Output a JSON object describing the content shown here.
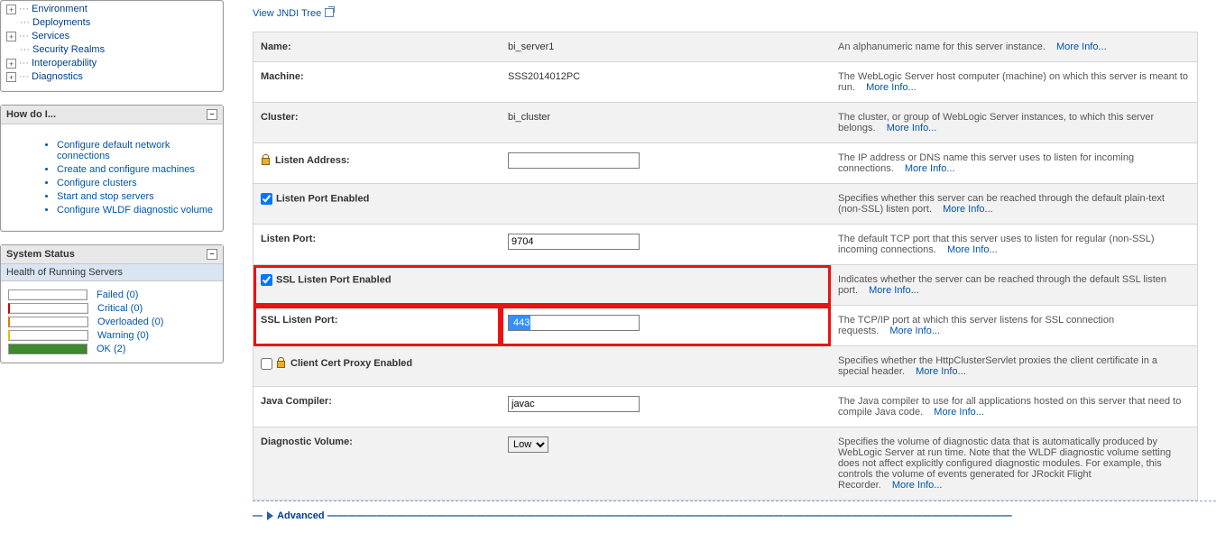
{
  "tree": {
    "items": [
      {
        "label": "Environment",
        "expand": true
      },
      {
        "label": "Deployments",
        "expand": false
      },
      {
        "label": "Services",
        "expand": true
      },
      {
        "label": "Security Realms",
        "expand": false
      },
      {
        "label": "Interoperability",
        "expand": true
      },
      {
        "label": "Diagnostics",
        "expand": true
      }
    ]
  },
  "howdoi": {
    "title": "How do I...",
    "items": [
      "Configure default network connections",
      "Create and configure machines",
      "Configure clusters",
      "Start and stop servers",
      "Configure WLDF diagnostic volume"
    ]
  },
  "status": {
    "title": "System Status",
    "subtitle": "Health of Running Servers",
    "rows": [
      {
        "label": "Failed (0)"
      },
      {
        "label": "Critical (0)"
      },
      {
        "label": "Overloaded (0)"
      },
      {
        "label": "Warning (0)"
      },
      {
        "label": "OK (2)"
      }
    ]
  },
  "jndi": {
    "label": "View JNDI Tree"
  },
  "fields": {
    "name": {
      "label": "Name:",
      "value": "bi_server1",
      "desc": "An alphanumeric name for this server instance.",
      "more": "More Info..."
    },
    "machine": {
      "label": "Machine:",
      "value": "SSS2014012PC",
      "desc": "The WebLogic Server host computer (machine) on which this server is meant to run.",
      "more": "More Info..."
    },
    "cluster": {
      "label": "Cluster:",
      "value": "bi_cluster",
      "desc": "The cluster, or group of WebLogic Server instances, to which this server belongs.",
      "more": "More Info..."
    },
    "listenaddr": {
      "label": "Listen Address:",
      "value": "",
      "desc": "The IP address or DNS name this server uses to listen for incoming connections.",
      "more": "More Info..."
    },
    "lpe": {
      "label": "Listen Port Enabled",
      "desc": "Specifies whether this server can be reached through the default plain-text (non-SSL) listen port.",
      "more": "More Info..."
    },
    "lp": {
      "label": "Listen Port:",
      "value": "9704",
      "desc": "The default TCP port that this server uses to listen for regular (non-SSL) incoming connections.",
      "more": "More Info..."
    },
    "sslpe": {
      "label": "SSL Listen Port Enabled",
      "desc": "Indicates whether the server can be reached through the default SSL listen port.",
      "more": "More Info..."
    },
    "sslp": {
      "label": "SSL Listen Port:",
      "value": "443",
      "desc": "The TCP/IP port at which this server listens for SSL connection requests.",
      "more": "More Info..."
    },
    "ccpe": {
      "label": "Client Cert Proxy Enabled",
      "desc": "Specifies whether the HttpClusterServlet proxies the client certificate in a special header.",
      "more": "More Info..."
    },
    "jc": {
      "label": "Java Compiler:",
      "value": "javac",
      "desc": "The Java compiler to use for all applications hosted on this server that need to compile Java code.",
      "more": "More Info..."
    },
    "dv": {
      "label": "Diagnostic Volume:",
      "value": "Low",
      "desc": "Specifies the volume of diagnostic data that is automatically produced by WebLogic Server at run time. Note that the WLDF diagnostic volume setting does not affect explicitly configured diagnostic modules. For example, this controls the volume of events generated for JRockit Flight Recorder.",
      "more": "More Info..."
    }
  },
  "advanced": {
    "label": "Advanced"
  }
}
